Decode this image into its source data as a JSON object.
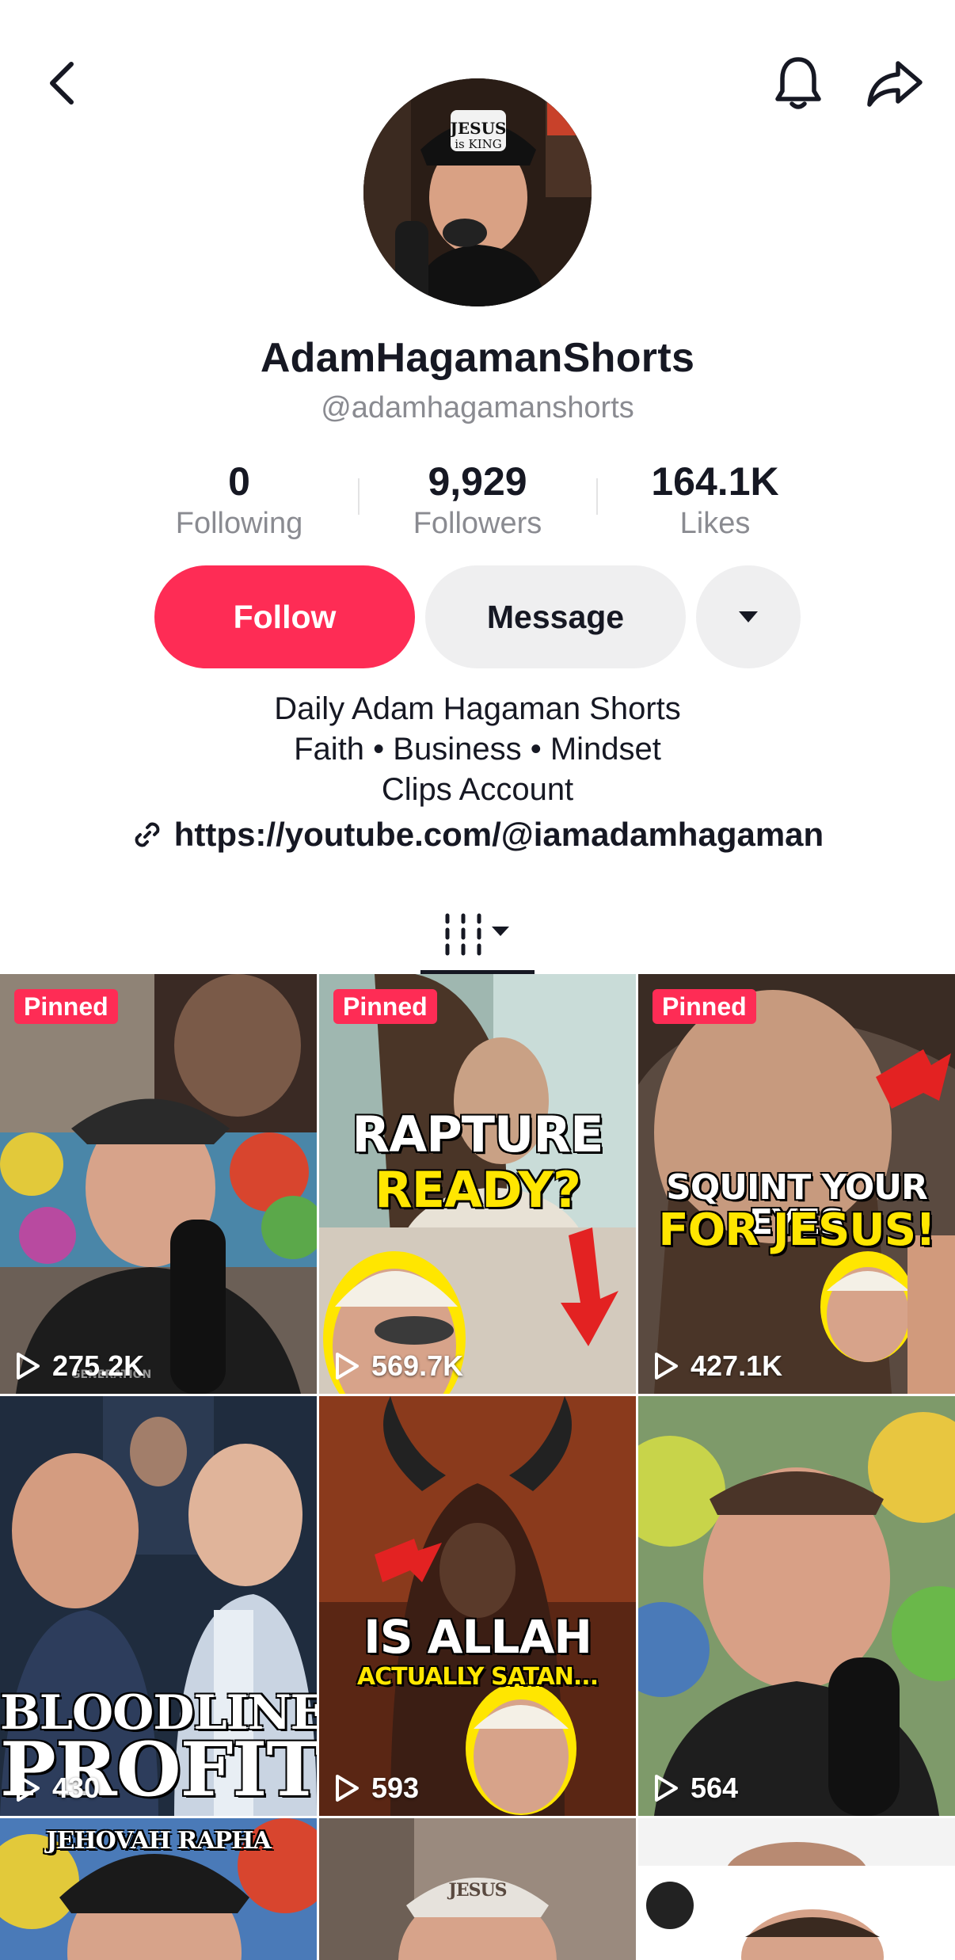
{
  "profile": {
    "display_name": "AdamHagamanShorts",
    "handle": "@adamhagamanshorts"
  },
  "stats": {
    "following_count": "0",
    "following_label": "Following",
    "followers_count": "9,929",
    "followers_label": "Followers",
    "likes_count": "164.1K",
    "likes_label": "Likes"
  },
  "actions": {
    "follow_label": "Follow",
    "message_label": "Message"
  },
  "bio": {
    "line1": "Daily Adam Hagaman Shorts",
    "line2": "Faith • Business • Mindset",
    "line3": "Clips Account",
    "link": "https://youtube.com/@iamadamhagaman"
  },
  "icons": {
    "back": "chevron-left-icon",
    "bell": "bell-icon",
    "share": "share-arrow-icon",
    "more": "caret-down-icon",
    "link": "link-icon",
    "videos_tab": "videos-grid-icon",
    "play": "play-icon"
  },
  "colors": {
    "accent": "#fe2c55",
    "secondary_button": "#efeff0",
    "muted_text": "#8a8b91"
  },
  "videos": [
    {
      "pinned": "Pinned",
      "views": "275.2K",
      "overlay": ""
    },
    {
      "pinned": "Pinned",
      "views": "569.7K",
      "overlay_line1": "RAPTURE",
      "overlay_line2": "READY?"
    },
    {
      "pinned": "Pinned",
      "views": "427.1K",
      "overlay_line1": "SQUINT YOUR EYES",
      "overlay_line2": "FOR JESUS!"
    },
    {
      "views": "430",
      "overlay_line1": "BLOODLINE",
      "overlay_line2": "PROFITS"
    },
    {
      "views": "593",
      "overlay_line1": "IS ALLAH",
      "overlay_line2": "ACTUALLY SATAN..."
    },
    {
      "views": "564"
    },
    {
      "cap_text": "JEHOVAH RAPHA"
    },
    {
      "cap_text": "JESUS"
    },
    {}
  ]
}
